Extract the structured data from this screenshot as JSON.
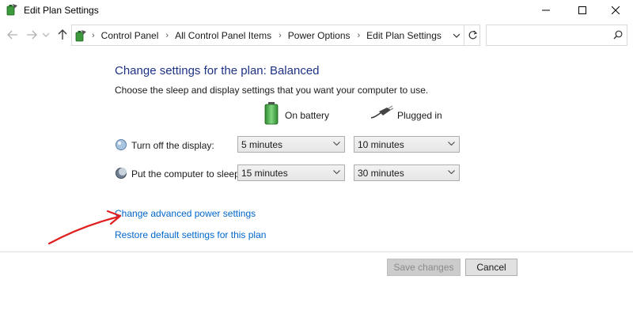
{
  "window": {
    "title": "Edit Plan Settings",
    "icon": "power-plan-icon"
  },
  "nav": {
    "breadcrumbs": [
      "Control Panel",
      "All Control Panel Items",
      "Power Options",
      "Edit Plan Settings"
    ],
    "search_placeholder": ""
  },
  "content": {
    "heading": "Change settings for the plan: Balanced",
    "subtext": "Choose the sleep and display settings that you want your computer to use.",
    "columns": {
      "battery": "On battery",
      "plugged": "Plugged in"
    },
    "rows": [
      {
        "label": "Turn off the display:",
        "battery": "5 minutes",
        "plugged": "10 minutes",
        "icon": "display-icon"
      },
      {
        "label": "Put the computer to sleep:",
        "battery": "15 minutes",
        "plugged": "30 minutes",
        "icon": "sleep-moon-icon"
      }
    ],
    "links": {
      "advanced": "Change advanced power settings",
      "restore": "Restore default settings for this plan"
    }
  },
  "buttons": {
    "save": "Save changes",
    "cancel": "Cancel"
  },
  "colors": {
    "heading": "#1e3287",
    "link": "#0066cc",
    "annotation": "#e02020"
  }
}
